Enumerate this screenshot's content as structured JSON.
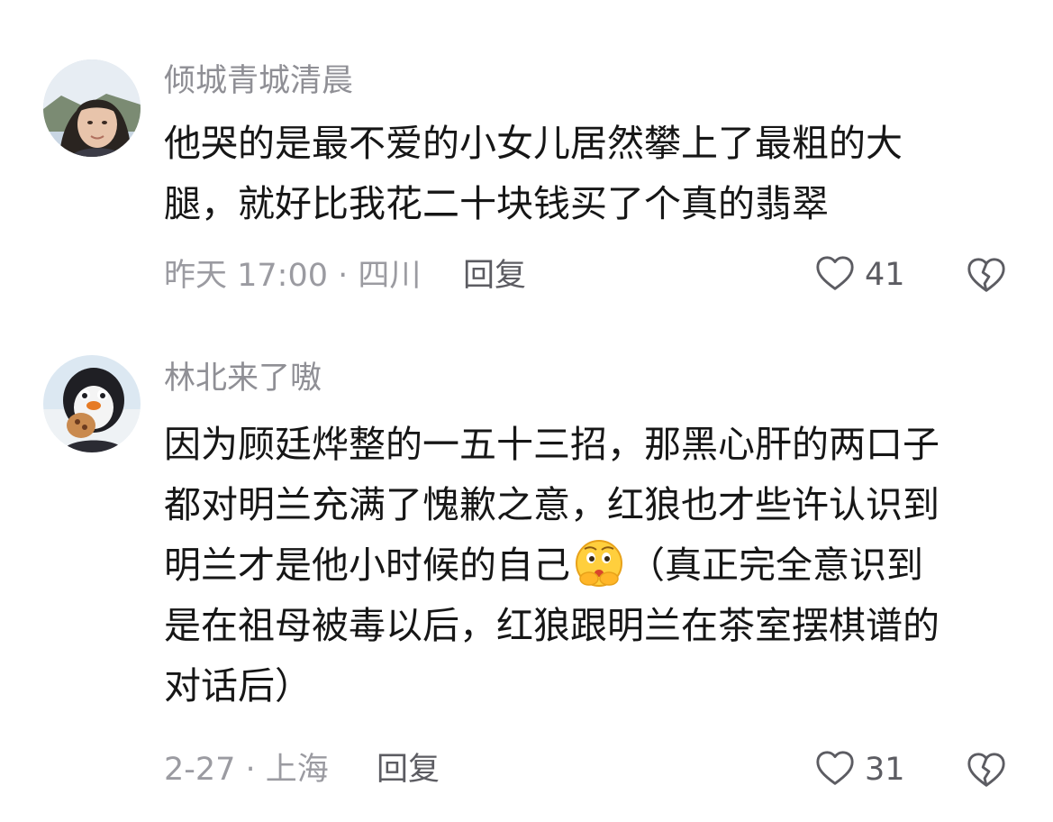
{
  "comments": [
    {
      "username": "倾城青城清晨",
      "text_lines": [
        "他哭的是最不爱的小女儿居然攀上了最粗的大",
        "腿，就好比我花二十块钱买了个真的翡翠"
      ],
      "meta": "昨天 17:00 · 四川",
      "reply_label": "回复",
      "like_count": "41",
      "like_icon": "heart-outline-icon",
      "dislike_icon": "broken-heart-icon",
      "avatar_icon": "avatar-woman-photo"
    },
    {
      "username": "林北来了嗷",
      "text_lines": [
        "因为顾廷烨整的一五十三招，那黑心肝的两口子",
        "都对明兰充满了愧歉之意，红狼也才些许认识到",
        "明兰才是他小时候的自己",
        "（真正完全意识到",
        "是在祖母被毒以后，红狼跟明兰在茶室摆棋谱的",
        "对话后）"
      ],
      "emoji_icon": "thinking-emoji-icon",
      "meta": "2-27 · 上海",
      "reply_label": "回复",
      "like_count": "31",
      "like_icon": "heart-outline-icon",
      "dislike_icon": "broken-heart-icon",
      "avatar_icon": "avatar-penguin-plush"
    }
  ],
  "colors": {
    "username": "#8f8f95",
    "body_text": "#161616",
    "meta": "#9b9ba1",
    "action": "#5c5c62"
  }
}
